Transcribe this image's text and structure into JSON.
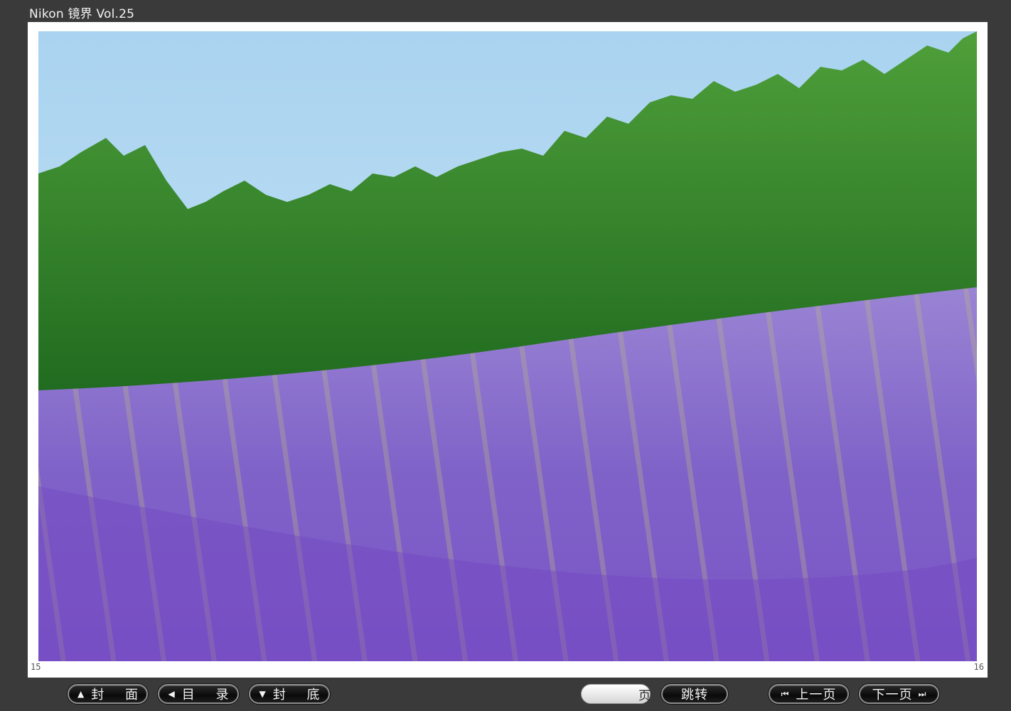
{
  "window": {
    "title": "Nikon 镜界 Vol.25"
  },
  "page": {
    "left_number": "15",
    "right_number": "16"
  },
  "photo": {
    "subject": "lavender-field-with-forest"
  },
  "toolbar": {
    "cover_label": "封 面",
    "toc_label": "目 录",
    "back_cover_label": "封 底",
    "page_input_value": "",
    "page_suffix": "页",
    "jump_label": "跳转",
    "prev_label": "上一页",
    "next_label": "下一页"
  },
  "icons": {
    "cover": "triangle-up-icon",
    "toc": "triangle-left-icon",
    "back_cover": "triangle-down-icon",
    "prev": "skip-back-icon",
    "next": "skip-forward-icon"
  },
  "colors": {
    "background": "#3a3a3a",
    "sky": "#bfe0f5",
    "forest": "#3e8e2f",
    "lavender": "#8a6ad0"
  }
}
